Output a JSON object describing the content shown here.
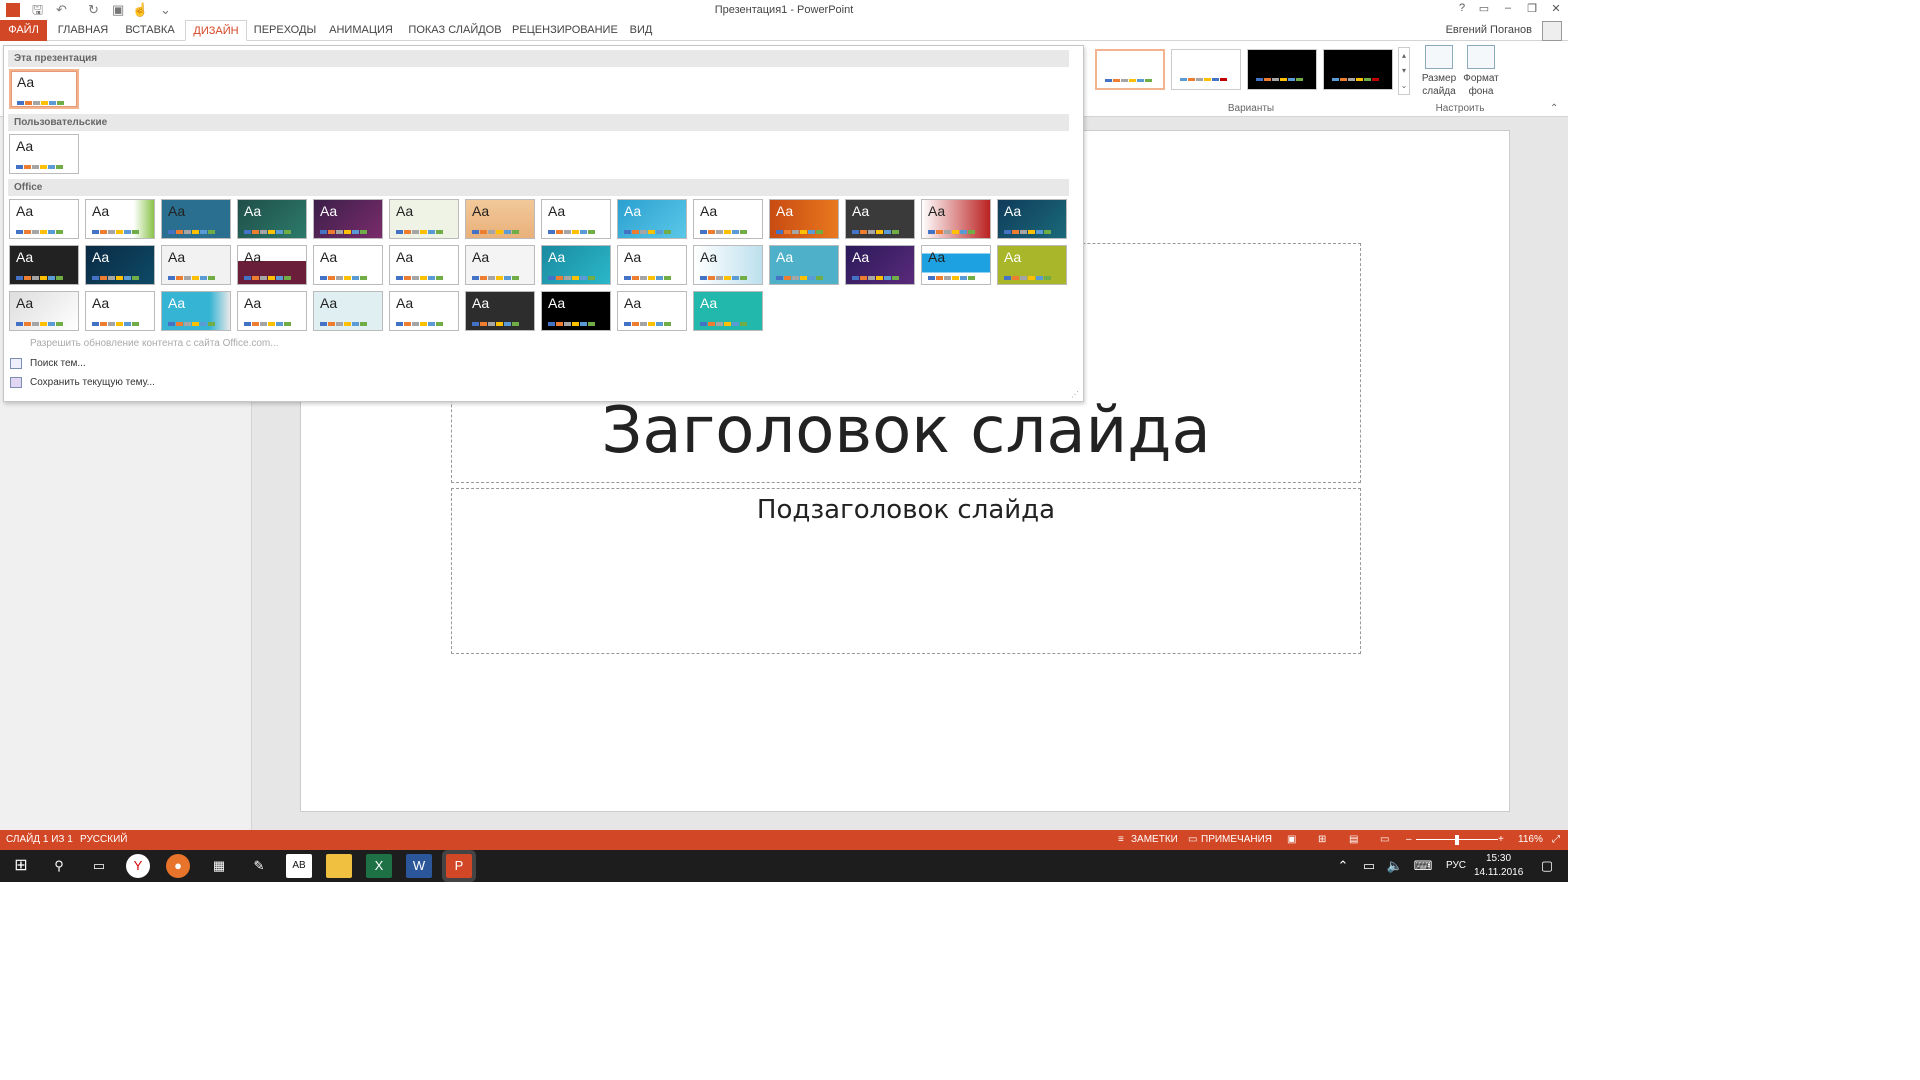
{
  "window": {
    "title": "Презентация1 - PowerPoint",
    "user": "Евгений Поганов"
  },
  "tabs": [
    {
      "label": "ФАЙЛ"
    },
    {
      "label": "ГЛАВНАЯ"
    },
    {
      "label": "ВСТАВКА"
    },
    {
      "label": "ДИЗАЙН"
    },
    {
      "label": "ПЕРЕХОДЫ"
    },
    {
      "label": "АНИМАЦИЯ"
    },
    {
      "label": "ПОКАЗ СЛАЙДОВ"
    },
    {
      "label": "РЕЦЕНЗИРОВАНИЕ"
    },
    {
      "label": "ВИД"
    }
  ],
  "ribbon": {
    "variants_label": "Варианты",
    "customize_label": "Настроить",
    "slide_size_label": "Размер слайда",
    "format_bg_label": "Формат фона"
  },
  "gallery": {
    "sections": [
      "Эта презентация",
      "Пользовательские",
      "Office"
    ],
    "theme_sample": "Aa",
    "menu": {
      "allow_update": "Разрешить обновление контента с сайта Office.com...",
      "browse": "Поиск тем...",
      "save": "Сохранить текущую тему..."
    }
  },
  "slide": {
    "title": "Заголовок слайда",
    "subtitle": "Подзаголовок слайда"
  },
  "status": {
    "slide": "СЛАЙД 1 ИЗ 1",
    "lang": "РУССКИЙ",
    "notes": "ЗАМЕТКИ",
    "comments": "ПРИМЕЧАНИЯ",
    "zoom": "116%"
  },
  "taskbar": {
    "lang": "РУС",
    "time": "15:30",
    "date": "14.11.2016"
  },
  "colors": {
    "accent": "#d24726"
  }
}
